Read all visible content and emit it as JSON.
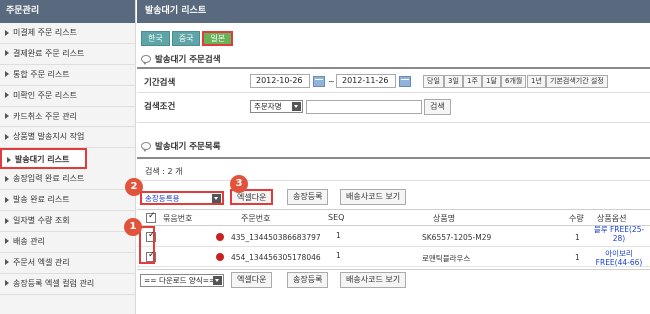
{
  "sidebar": {
    "title": "주문관리",
    "items": [
      {
        "label": "미결제 주문 리스트"
      },
      {
        "label": "결제완료 주문 리스트"
      },
      {
        "label": "통합 주문 리스트"
      },
      {
        "label": "미확인 주문 리스트"
      },
      {
        "label": "카드취소 주문 관리"
      },
      {
        "label": "상품별 발송지시 작업"
      },
      {
        "label": "발송대기 리스트"
      },
      {
        "label": "송장입력 완료 리스트"
      },
      {
        "label": "발송 완료 리스트"
      },
      {
        "label": "일자별 수량 조회"
      },
      {
        "label": "배송 관리"
      },
      {
        "label": "주문서 엑셀 관리"
      },
      {
        "label": "송장등록 엑셀 컬럼 관리"
      }
    ],
    "active_index": 6
  },
  "header": {
    "title": "발송대기 리스트"
  },
  "lang_tabs": [
    {
      "label": "한국"
    },
    {
      "label": "중국"
    },
    {
      "label": "일본"
    }
  ],
  "search": {
    "section_title": "발송대기 주문검색",
    "period_label": "기간검색",
    "date_from": "2012-10-26",
    "date_to": "2012-11-26",
    "tilde": "~",
    "quick_buttons": [
      "당일",
      "3일",
      "1주",
      "1달",
      "6개월",
      "1년",
      "기본검색기간 설정"
    ],
    "condition_label": "검색조건",
    "condition_select": "주문자명",
    "search_button": "검색"
  },
  "list": {
    "section_title": "발송대기 주문목록",
    "count_text": "검색 : 2 개",
    "status_select": "송장등록용",
    "excel_button": "엑셀다운",
    "invoice_button": "송장등록",
    "barcode_button": "배송사코드 보기",
    "columns": [
      "묶음번호",
      "주문번호",
      "SEQ",
      "상품명",
      "수량",
      "상품옵션"
    ],
    "rows": [
      {
        "order_no": "435_134450386683797",
        "seq": "1",
        "product": "SK6557-1205-M29",
        "qty": "1",
        "option": "블루 FREE(25-28)"
      },
      {
        "order_no": "454_134456305178046",
        "seq": "1",
        "product": "로맨틱블라우스",
        "qty": "1",
        "option": "아이보리 FREE(44-66)"
      }
    ],
    "download_select": "== 다운로드 양식==",
    "badges": [
      "1",
      "2",
      "3"
    ]
  },
  "colors": {
    "header_bg": "#5a6a7e",
    "highlight": "#e23b3b",
    "badge": "#e2533b",
    "tab": "#5fa5a8",
    "tab_selected": "#68b35a"
  }
}
